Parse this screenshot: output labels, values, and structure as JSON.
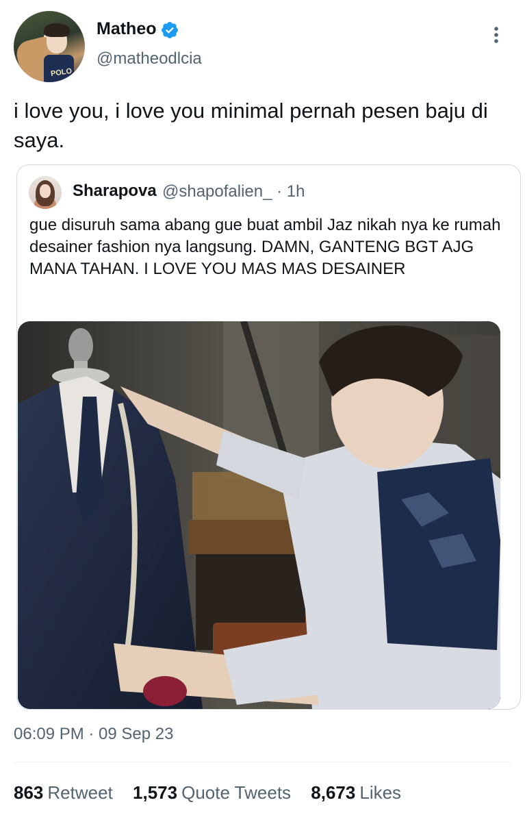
{
  "tweet": {
    "author": {
      "display_name": "Matheo",
      "handle": "@matheodlcia",
      "verified": true,
      "avatar_shirt_text": "POLO"
    },
    "text": "i love you, i love you minimal pernah pesen baju di saya.",
    "timestamp": "06:09 PM · 09 Sep 23",
    "stats": {
      "retweets": "863",
      "retweets_label": "Retweet",
      "quote_tweets": "1,573",
      "quote_tweets_label": "Quote Tweets",
      "likes": "8,673",
      "likes_label": "Likes"
    }
  },
  "quoted_tweet": {
    "display_name": "Sharapova",
    "handle_time": "@shapofalien_ · 1h",
    "text": "gue disuruh sama abang gue buat ambil Jaz nikah nya ke rumah desainer fashion nya langsung. DAMN, GANTENG BGT AJG MANA TAHAN. I LOVE YOU MAS MAS DESAINER",
    "photo": "tailor-adjusting-suit-on-mannequin"
  },
  "icons": {
    "verified": "verified-badge-icon",
    "more": "more-options-icon"
  },
  "colors": {
    "verified_blue": "#1d9bf0",
    "text_primary": "#0f1419",
    "text_secondary": "#536471",
    "border": "#cfd9de"
  }
}
